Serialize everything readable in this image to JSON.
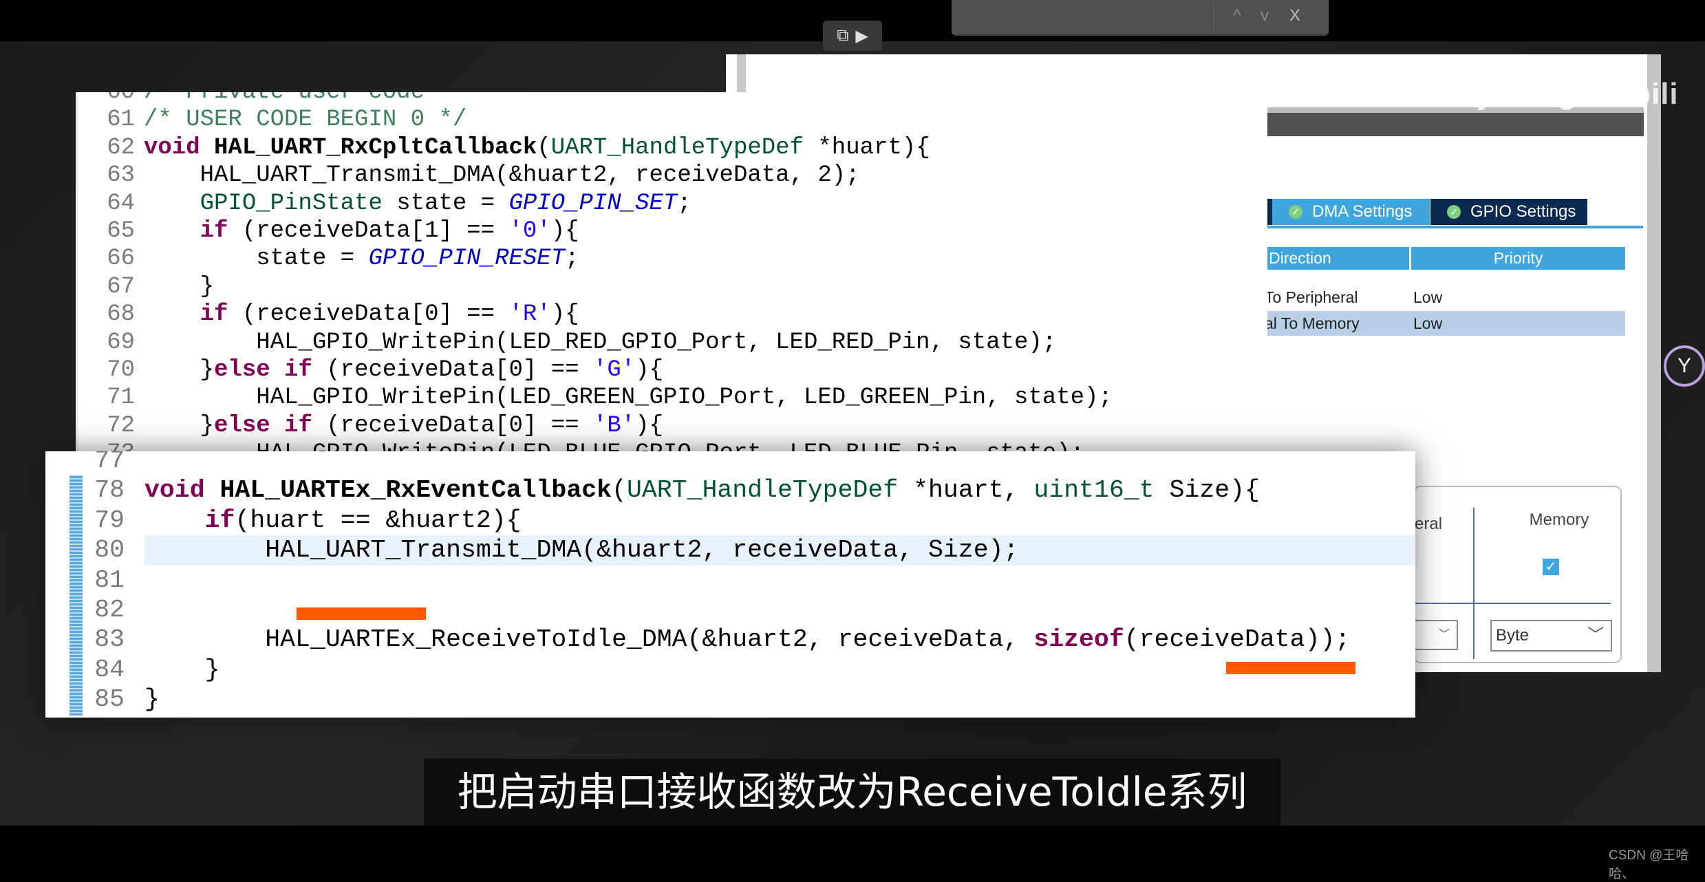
{
  "find_bar": {
    "prev_icon": "chevron-up-icon",
    "next_icon": "chevron-down-icon",
    "close_icon": "close-icon",
    "prev": "^",
    "next": "v",
    "close": "X"
  },
  "video_tools": {
    "pip_icon": "picture-in-picture-icon",
    "ai_icon": "video-sparkle-icon"
  },
  "watermark": "keysking bilibili",
  "cubemx": {
    "tabs": [
      {
        "label": "DMA Settings",
        "active": false
      },
      {
        "label": "GPIO Settings",
        "active": true
      }
    ],
    "table": {
      "headers": [
        "Direction",
        "Priority"
      ],
      "rows": [
        {
          "direction": "To Peripheral",
          "priority": "Low",
          "selected": false
        },
        {
          "direction": "al To Memory",
          "priority": "Low",
          "selected": true
        }
      ]
    },
    "increment": {
      "peripheral_label": "eral",
      "memory_label": "Memory",
      "memory_checked": true,
      "memory_data_width": "Byte"
    }
  },
  "editor_top": {
    "lines": [
      {
        "n": "60",
        "tokens": [
          {
            "c": "cm",
            "t": "/* Private user code"
          }
        ]
      },
      {
        "n": "61",
        "tokens": [
          {
            "c": "cm",
            "t": "/* USER CODE BEGIN 0 */"
          }
        ]
      },
      {
        "n": "62",
        "tokens": [
          {
            "c": "k",
            "t": "void "
          },
          {
            "c": "fn",
            "t": "HAL_UART_RxCpltCallback"
          },
          {
            "c": "pl",
            "t": "("
          },
          {
            "c": "ty",
            "t": "UART_HandleTypeDef"
          },
          {
            "c": "pl",
            "t": " *huart){"
          }
        ]
      },
      {
        "n": "63",
        "tokens": [
          {
            "c": "pl",
            "t": "    HAL_UART_Transmit_DMA(&huart2, receiveData, 2);"
          }
        ]
      },
      {
        "n": "64",
        "tokens": [
          {
            "c": "ty",
            "t": "    GPIO_PinState"
          },
          {
            "c": "pl",
            "t": " state = "
          },
          {
            "c": "mc",
            "t": "GPIO_PIN_SET"
          },
          {
            "c": "pl",
            "t": ";"
          }
        ]
      },
      {
        "n": "65",
        "tokens": [
          {
            "c": "k",
            "t": "    if"
          },
          {
            "c": "pl",
            "t": " (receiveData[1] == "
          },
          {
            "c": "st",
            "t": "'0'"
          },
          {
            "c": "pl",
            "t": "){"
          }
        ]
      },
      {
        "n": "66",
        "tokens": [
          {
            "c": "pl",
            "t": "        state = "
          },
          {
            "c": "mc",
            "t": "GPIO_PIN_RESET"
          },
          {
            "c": "pl",
            "t": ";"
          }
        ]
      },
      {
        "n": "67",
        "tokens": [
          {
            "c": "pl",
            "t": "    }"
          }
        ]
      },
      {
        "n": "68",
        "tokens": [
          {
            "c": "k",
            "t": "    if"
          },
          {
            "c": "pl",
            "t": " (receiveData[0] == "
          },
          {
            "c": "st",
            "t": "'R'"
          },
          {
            "c": "pl",
            "t": "){"
          }
        ]
      },
      {
        "n": "69",
        "tokens": [
          {
            "c": "pl",
            "t": "        HAL_GPIO_WritePin(LED_RED_GPIO_Port, LED_RED_Pin, state);"
          }
        ]
      },
      {
        "n": "70",
        "tokens": [
          {
            "c": "pl",
            "t": "    }"
          },
          {
            "c": "k",
            "t": "else if"
          },
          {
            "c": "pl",
            "t": " (receiveData[0] == "
          },
          {
            "c": "st",
            "t": "'G'"
          },
          {
            "c": "pl",
            "t": "){"
          }
        ]
      },
      {
        "n": "71",
        "tokens": [
          {
            "c": "pl",
            "t": "        HAL_GPIO_WritePin(LED_GREEN_GPIO_Port, LED_GREEN_Pin, state);"
          }
        ]
      },
      {
        "n": "72",
        "tokens": [
          {
            "c": "pl",
            "t": "    }"
          },
          {
            "c": "k",
            "t": "else if"
          },
          {
            "c": "pl",
            "t": " (receiveData[0] == "
          },
          {
            "c": "st",
            "t": "'B'"
          },
          {
            "c": "pl",
            "t": "){"
          }
        ]
      },
      {
        "n": "73",
        "tokens": [
          {
            "c": "pl",
            "t": "        HAL_GPIO_WritePin(LED_BLUE_GPIO_Port, LED_BLUE_Pin, state);"
          }
        ]
      }
    ]
  },
  "editor_bottom": {
    "highlight_line": "80",
    "lines": [
      {
        "n": "77",
        "tokens": []
      },
      {
        "n": "78",
        "tokens": [
          {
            "c": "k",
            "t": "void "
          },
          {
            "c": "fn",
            "t": "HAL_UARTEx_RxEventCallback"
          },
          {
            "c": "pl",
            "t": "("
          },
          {
            "c": "ty",
            "t": "UART_HandleTypeDef"
          },
          {
            "c": "pl",
            "t": " *huart, "
          },
          {
            "c": "ty",
            "t": "uint16_t"
          },
          {
            "c": "pl",
            "t": " Size){"
          }
        ]
      },
      {
        "n": "79",
        "tokens": [
          {
            "c": "k",
            "t": "    if"
          },
          {
            "c": "pl",
            "t": "(huart == &huart2){"
          }
        ]
      },
      {
        "n": "80",
        "tokens": [
          {
            "c": "pl",
            "t": "        HAL_UART_Transmit_DMA(&huart2, receiveData, Size);"
          }
        ]
      },
      {
        "n": "81",
        "tokens": []
      },
      {
        "n": "82",
        "tokens": []
      },
      {
        "n": "83",
        "tokens": [
          {
            "c": "pl",
            "t": "        HAL_UARTEx_ReceiveToIdle_DMA(&huart2, receiveData, "
          },
          {
            "c": "k",
            "t": "sizeof"
          },
          {
            "c": "pl",
            "t": "(receiveData));"
          }
        ]
      },
      {
        "n": "84",
        "tokens": [
          {
            "c": "pl",
            "t": "    }"
          }
        ]
      },
      {
        "n": "85",
        "tokens": [
          {
            "c": "pl",
            "t": "}"
          }
        ]
      }
    ]
  },
  "annotation_color": "#ff5a00",
  "subtitle": "把启动串口接收函数改为ReceiveToIdle系列",
  "credit": "CSDN @王哈哈、"
}
